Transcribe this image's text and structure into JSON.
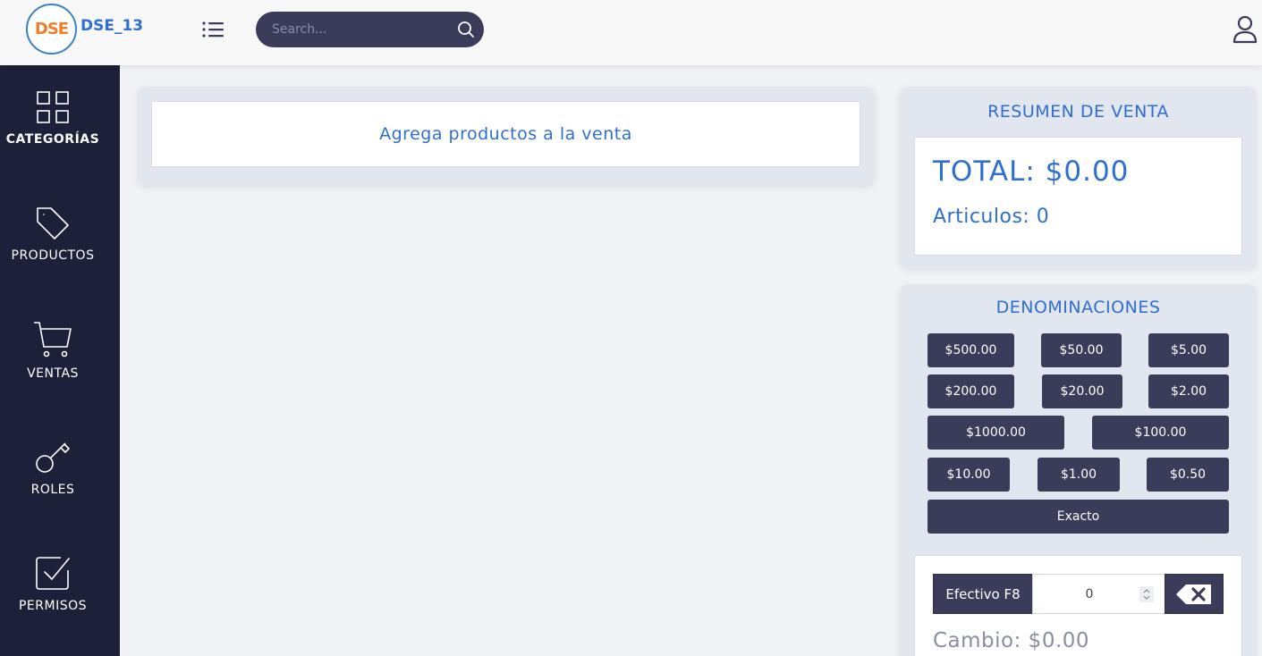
{
  "app": {
    "brand": "DSE_13",
    "logo_text": "DSE"
  },
  "header": {
    "search_placeholder": "Search..."
  },
  "sidebar": {
    "items": [
      {
        "label": "CATEGORÍAS",
        "icon": "grid-icon",
        "active": true
      },
      {
        "label": "PRODUCTOS",
        "icon": "tag-icon",
        "active": false
      },
      {
        "label": "VENTAS",
        "icon": "cart-icon",
        "active": false
      },
      {
        "label": "ROLES",
        "icon": "key-icon",
        "active": false
      },
      {
        "label": "PERMISOS",
        "icon": "checkbox-icon",
        "active": false
      }
    ]
  },
  "cart": {
    "empty_message": "Agrega productos a la venta"
  },
  "summary": {
    "title": "RESUMEN DE VENTA",
    "total": "TOTAL: $0.00",
    "items": "Articulos: 0"
  },
  "denominations": {
    "title": "DENOMINACIONES",
    "buttons": [
      "$500.00",
      "$50.00",
      "$5.00",
      "$200.00",
      "$20.00",
      "$2.00",
      "$1000.00",
      "$100.00",
      "$10.00",
      "$1.00",
      "$0.50",
      "Exacto"
    ]
  },
  "payment": {
    "cash_label": "Efectivo F8",
    "cash_value": "0",
    "change": "Cambio: $0.00"
  },
  "colors": {
    "accent": "#2f6fcf",
    "sidebar": "#1d2039",
    "button": "#3a3c5a",
    "logo": "#f07d2c"
  }
}
